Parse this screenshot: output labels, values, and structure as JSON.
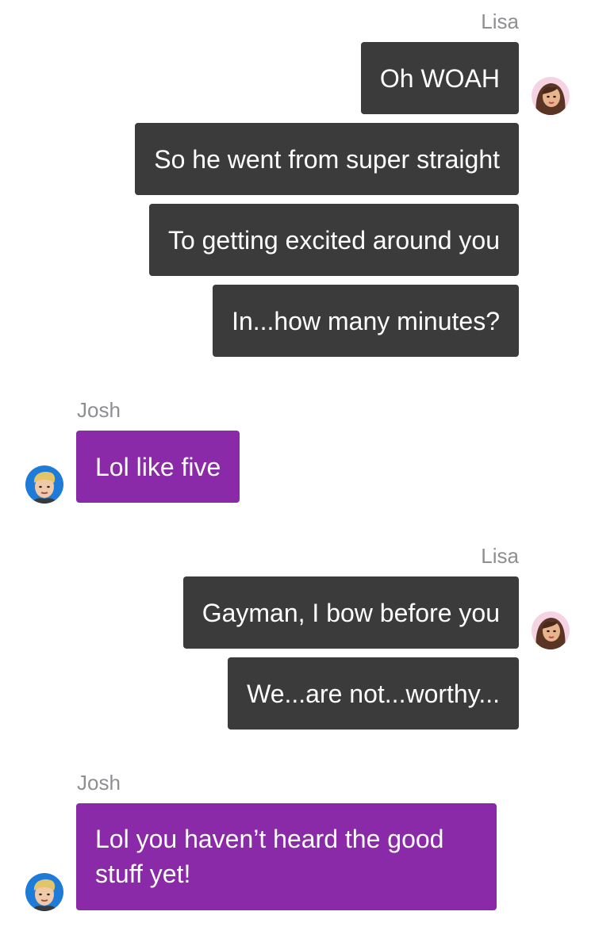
{
  "conversation": {
    "group1": {
      "sender": "Lisa",
      "messages": [
        "Oh WOAH",
        "So he went from super straight",
        "To getting excited around you",
        "In...how many minutes?"
      ]
    },
    "group2": {
      "sender": "Josh",
      "messages": [
        "Lol like five"
      ]
    },
    "group3": {
      "sender": "Lisa",
      "messages": [
        "Gayman, I bow before you",
        "We...are not...worthy..."
      ]
    },
    "group4": {
      "sender": "Josh",
      "messages": [
        "Lol you haven’t heard the good stuff yet!"
      ]
    }
  },
  "colors": {
    "lisa_bubble": "#3b3b3b",
    "josh_bubble": "#8a2aa8",
    "sender_name": "#8e8e93",
    "background": "#ffffff"
  },
  "icons": {
    "lisa_avatar": "lisa-avatar",
    "josh_avatar": "josh-avatar"
  }
}
